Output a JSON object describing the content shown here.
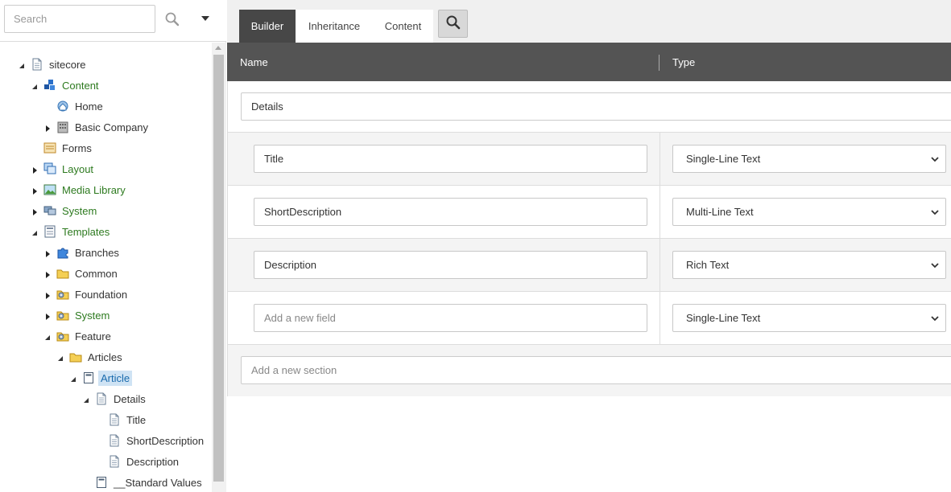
{
  "search": {
    "placeholder": "Search"
  },
  "tree": {
    "nodes": [
      {
        "label": "sitecore",
        "icon": "document-icon",
        "color": "dark",
        "toggle": "expanded"
      },
      {
        "label": "Content",
        "icon": "content-cubes-icon",
        "color": "green",
        "toggle": "expanded"
      },
      {
        "label": "Home",
        "icon": "home-globe-icon",
        "color": "dark",
        "toggle": "none"
      },
      {
        "label": "Basic Company",
        "icon": "building-icon",
        "color": "dark",
        "toggle": "collapsed"
      },
      {
        "label": "Forms",
        "icon": "forms-icon",
        "color": "dark",
        "toggle": "none"
      },
      {
        "label": "Layout",
        "icon": "layout-windows-icon",
        "color": "green",
        "toggle": "collapsed"
      },
      {
        "label": "Media Library",
        "icon": "picture-icon",
        "color": "green",
        "toggle": "collapsed"
      },
      {
        "label": "System",
        "icon": "computers-icon",
        "color": "green",
        "toggle": "collapsed"
      },
      {
        "label": "Templates",
        "icon": "templates-icon",
        "color": "green",
        "toggle": "expanded"
      },
      {
        "label": "Branches",
        "icon": "puzzle-icon",
        "color": "dark",
        "toggle": "collapsed"
      },
      {
        "label": "Common",
        "icon": "folder-icon",
        "color": "dark",
        "toggle": "collapsed"
      },
      {
        "label": "Foundation",
        "icon": "folder-gear-icon",
        "color": "dark",
        "toggle": "collapsed"
      },
      {
        "label": "System",
        "icon": "folder-gear-icon",
        "color": "green",
        "toggle": "collapsed"
      },
      {
        "label": "Feature",
        "icon": "folder-gear-icon",
        "color": "dark",
        "toggle": "expanded"
      },
      {
        "label": "Articles",
        "icon": "folder-icon",
        "color": "dark",
        "toggle": "expanded"
      },
      {
        "label": "Article",
        "icon": "template-icon",
        "color": "selected",
        "toggle": "expanded"
      },
      {
        "label": "Details",
        "icon": "document-icon",
        "color": "dark",
        "toggle": "expanded"
      },
      {
        "label": "Title",
        "icon": "document-icon",
        "color": "dark",
        "toggle": "none"
      },
      {
        "label": "ShortDescription",
        "icon": "document-icon",
        "color": "dark",
        "toggle": "none"
      },
      {
        "label": "Description",
        "icon": "document-icon",
        "color": "dark",
        "toggle": "none"
      },
      {
        "label": "__Standard Values",
        "icon": "template-icon",
        "color": "dark",
        "toggle": "none"
      }
    ]
  },
  "tabs": [
    {
      "label": "Builder",
      "active": true
    },
    {
      "label": "Inheritance",
      "active": false
    },
    {
      "label": "Content",
      "active": false
    }
  ],
  "header": {
    "name": "Name",
    "type": "Type"
  },
  "section": {
    "value": "Details"
  },
  "fields": [
    {
      "name": "Title",
      "placeholder": "",
      "type": "Single-Line Text"
    },
    {
      "name": "ShortDescription",
      "placeholder": "",
      "type": "Multi-Line Text"
    },
    {
      "name": "Description",
      "placeholder": "",
      "type": "Rich Text"
    },
    {
      "name": "",
      "placeholder": "Add a new field",
      "type": "Single-Line Text"
    }
  ],
  "new_section": {
    "placeholder": "Add a new section"
  }
}
